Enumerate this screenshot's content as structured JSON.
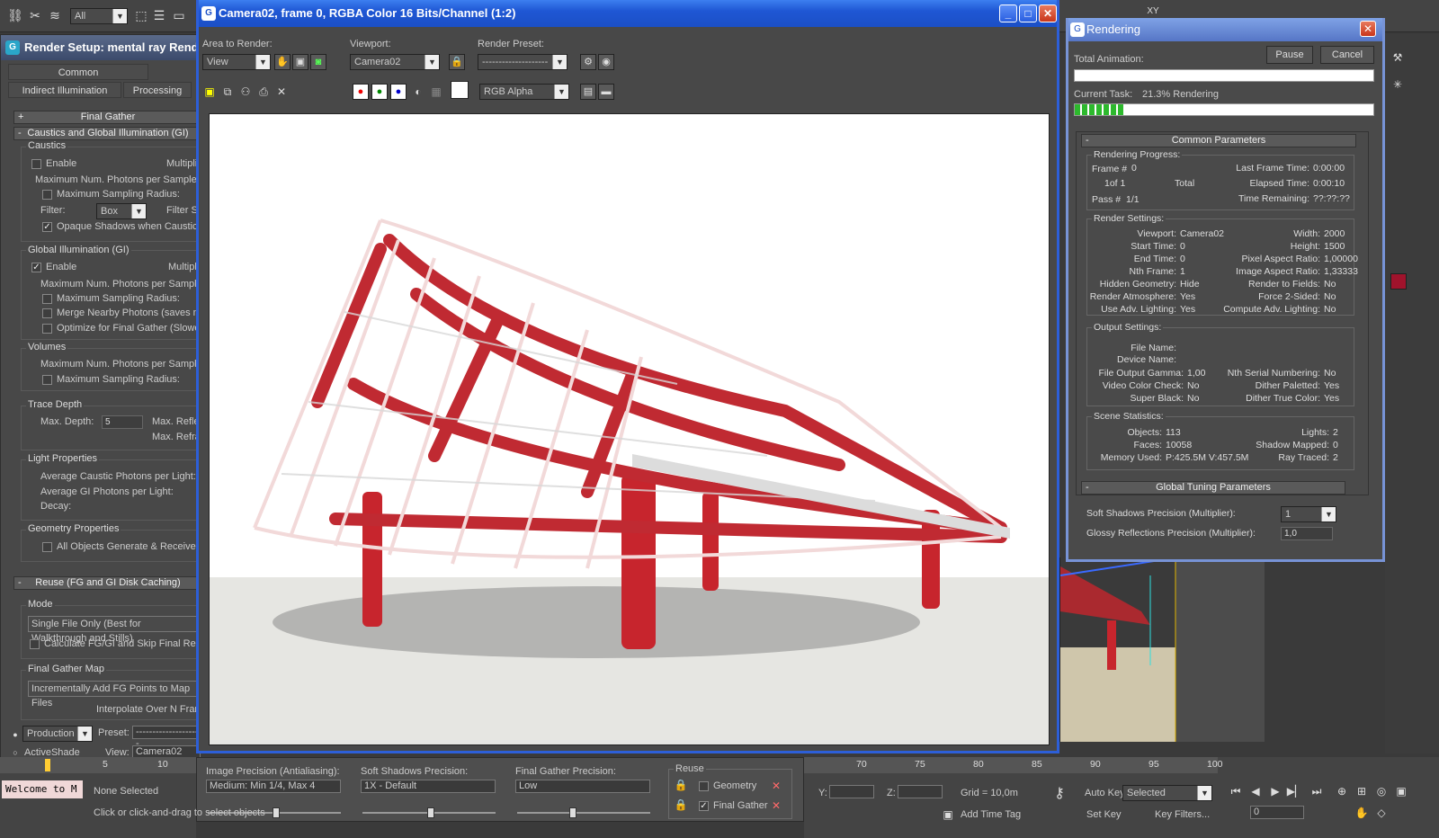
{
  "toolbar": {
    "selection_filter": "All"
  },
  "render_setup": {
    "title": "Render Setup: mental ray Renderer",
    "tabs": [
      "Common",
      "Indirect Illumination",
      "Processing"
    ],
    "final_gather_rollout": "Final Gather",
    "caustics_rollout": "Caustics and Global Illumination (GI)",
    "caustics": {
      "group": "Caustics",
      "enable": "Enable",
      "multiplier": "Multiplier",
      "max_photons": "Maximum Num. Photons per Sample:",
      "max_radius": "Maximum Sampling Radius:",
      "filter_label": "Filter:",
      "filter_value": "Box",
      "filter_size": "Filter Size",
      "opaque": "Opaque Shadows when Caustics are Enabled"
    },
    "gi": {
      "group": "Global Illumination (GI)",
      "enable": "Enable",
      "multiplier": "Multiplier",
      "max_photons": "Maximum Num. Photons per Sample:",
      "max_radius": "Maximum Sampling Radius:",
      "merge": "Merge Nearby Photons (saves memory)",
      "optimize": "Optimize for Final Gather (Slower GI)"
    },
    "volumes": {
      "group": "Volumes",
      "max_photons": "Maximum Num. Photons per Sample:",
      "max_radius": "Maximum Sampling Radius:"
    },
    "trace": {
      "group": "Trace Depth",
      "max_depth": "Max. Depth:",
      "max_depth_val": "5",
      "max_refl": "Max. Reflections:",
      "max_refr": "Max. Refractions:"
    },
    "light": {
      "group": "Light Properties",
      "caustic": "Average Caustic Photons per Light:",
      "gi": "Average GI Photons per Light:",
      "decay": "Decay:"
    },
    "geometry": {
      "group": "Geometry Properties",
      "all_objects": "All Objects Generate & Receive GI and Caustics"
    },
    "reuse_rollout": "Reuse (FG and GI Disk Caching)",
    "mode": {
      "group": "Mode",
      "value": "Single File Only (Best for Walkthrough and Stills)",
      "calc": "Calculate FG/GI and Skip Final Rendering"
    },
    "fg_map": {
      "group": "Final Gather Map",
      "value": "Incrementally Add FG Points to Map Files",
      "interp": "Interpolate Over N Frames:"
    },
    "bottom": {
      "production": "Production",
      "activeshade": "ActiveShade",
      "preset_label": "Preset:",
      "preset_value": "--------------------",
      "view_label": "View:",
      "view_value": "Camera02"
    }
  },
  "frame_window": {
    "title": "Camera02, frame 0, RGBA Color 16 Bits/Channel (1:2)",
    "area_label": "Area to Render:",
    "area_value": "View",
    "viewport_label": "Viewport:",
    "viewport_value": "Camera02",
    "preset_label": "Render Preset:",
    "preset_value": "--------------------",
    "channel_value": "RGB Alpha"
  },
  "bottom_panel": {
    "image_precision_label": "Image Precision (Antialiasing):",
    "image_precision_value": "Medium: Min 1/4, Max 4",
    "soft_shadows_label": "Soft Shadows Precision:",
    "soft_shadows_value": "1X - Default",
    "fg_precision_label": "Final Gather Precision:",
    "fg_precision_value": "Low",
    "reuse_label": "Reuse",
    "geometry": "Geometry",
    "final_gather": "Final Gather"
  },
  "rendering": {
    "title": "Rendering",
    "pause": "Pause",
    "cancel": "Cancel",
    "total_animation": "Total Animation:",
    "current_task": "Current Task:",
    "current_task_value": "21.3%  Rendering",
    "current_progress": 0.213,
    "common_params": "Common Parameters",
    "progress": {
      "group": "Rendering Progress:",
      "frame_label": "Frame #",
      "frame_val": "0",
      "of": "1of 1",
      "total": "Total",
      "pass_label": "Pass #",
      "pass_val": "1/1",
      "last_frame": "Last Frame Time:",
      "last_frame_val": "0:00:00",
      "elapsed": "Elapsed Time:",
      "elapsed_val": "0:00:10",
      "remaining": "Time Remaining:",
      "remaining_val": "??:??:??"
    },
    "settings": {
      "group": "Render Settings:",
      "rows_left": [
        [
          "Viewport:",
          "Camera02"
        ],
        [
          "Start Time:",
          "0"
        ],
        [
          "End Time:",
          "0"
        ],
        [
          "Nth Frame:",
          "1"
        ],
        [
          "Hidden Geometry:",
          "Hide"
        ],
        [
          "Render Atmosphere:",
          "Yes"
        ],
        [
          "Use Adv. Lighting:",
          "Yes"
        ]
      ],
      "rows_right": [
        [
          "Width:",
          "2000"
        ],
        [
          "Height:",
          "1500"
        ],
        [
          "Pixel Aspect Ratio:",
          "1,00000"
        ],
        [
          "Image Aspect Ratio:",
          "1,33333"
        ],
        [
          "Render to Fields:",
          "No"
        ],
        [
          "Force 2-Sided:",
          "No"
        ],
        [
          "Compute Adv. Lighting:",
          "No"
        ]
      ]
    },
    "output": {
      "group": "Output Settings:",
      "file_name": "File Name:",
      "device_name": "Device Name:",
      "rows_left": [
        [
          "File Output Gamma:",
          "1,00"
        ],
        [
          "Video Color Check:",
          "No"
        ],
        [
          "Super Black:",
          "No"
        ]
      ],
      "rows_right": [
        [
          "Nth Serial Numbering:",
          "No"
        ],
        [
          "Dither Paletted:",
          "Yes"
        ],
        [
          "Dither True Color:",
          "Yes"
        ]
      ]
    },
    "scene": {
      "group": "Scene Statistics:",
      "rows_left": [
        [
          "Objects:",
          "113"
        ],
        [
          "Faces:",
          "10058"
        ],
        [
          "Memory Used:",
          "P:425.5M V:457.5M"
        ]
      ],
      "rows_right": [
        [
          "Lights:",
          "2"
        ],
        [
          "Shadow Mapped:",
          "0"
        ],
        [
          "Ray Traced:",
          "2"
        ]
      ]
    },
    "global_tuning": "Global Tuning Parameters",
    "soft_shadows": "Soft Shadows Precision (Multiplier):",
    "soft_shadows_val": "1",
    "glossy": "Glossy Reflections Precision (Multiplier):",
    "glossy_val": "1,0"
  },
  "status": {
    "welcome": "Welcome to M",
    "none_selected": "None Selected",
    "hint": "Click or click-and-drag to select objects",
    "timeline_ticks_left": [
      "5",
      "10"
    ],
    "timeline_ticks_right": [
      "70",
      "75",
      "80",
      "85",
      "90",
      "95",
      "100"
    ],
    "y_label": "Y:",
    "z_label": "Z:",
    "grid": "Grid = 10,0m",
    "add_time_tag": "Add Time Tag",
    "auto_key": "Auto Key",
    "set_key": "Set Key",
    "selected": "Selected",
    "key_filters": "Key Filters...",
    "frame": "0"
  },
  "topright": {
    "xy": "XY"
  }
}
